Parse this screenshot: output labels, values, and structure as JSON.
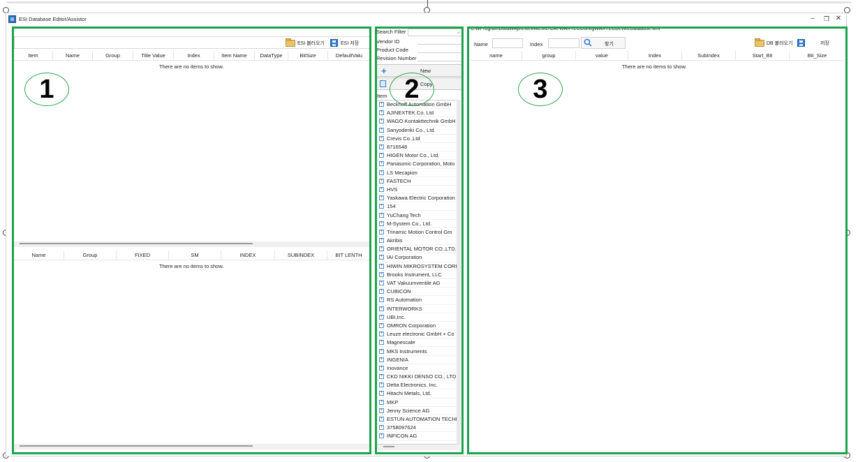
{
  "window": {
    "title": "ESI Database Editor/Assistor",
    "minimize_glyph": "–",
    "restore_glyph": "❐",
    "close_glyph": "✕"
  },
  "labels": {
    "region_1": "1",
    "region_2": "2",
    "region_3": "3"
  },
  "panel1": {
    "toolbar": {
      "load_label": "ESI 불러오기",
      "save_label": "ESI 저장"
    },
    "top_grid": {
      "columns": [
        "Item",
        "Name",
        "Group",
        "Title Value",
        "Index",
        "Item Name",
        "DataType",
        "BitSize",
        "DefaultValu"
      ],
      "empty_text": "There are no items to show."
    },
    "bottom_grid": {
      "columns": [
        "Name",
        "Group",
        "FIXED",
        "SM",
        "INDEX",
        "SUBINDEX",
        "BIT LENTH"
      ],
      "empty_text": "There are no items to show."
    }
  },
  "panel2": {
    "search_filter_label": "Search Filter",
    "search_filter_value": "",
    "vendor_id_label": "Vendor ID",
    "product_code_label": "Product Code",
    "revision_number_label": "Revision Number",
    "new_label": "New",
    "copy_label": "Copy",
    "list_header": "Item",
    "items": [
      "Beckhoff Automation GmbH",
      "AJINEXTEK Co. Ltd",
      "WAGO Kontakttechnik GmbH",
      "Sanyodenki Co., Ltd.",
      "Crevis Co.,Ltd",
      "8716548",
      "HIGEN Motor Co., Ltd.",
      "Panasonic Corporation, Moto",
      "LS Mecapion",
      "FASTECH",
      "HVS",
      "Yaskawa Electric Corporation",
      "154",
      "YuChang Tech",
      "M-System Co., Ltd.",
      "Trinamic Motion Control Gm",
      "Akribis",
      "ORIENTAL MOTOR CO.,LTD.",
      "IAI Corporation",
      "HIWIN MIKROSYSTEM CORP.",
      "Brooks Instrument, LLC",
      "VAT Vakuumventile AG",
      "CUBICON",
      "RS Automation",
      "INTERWORKS",
      "UBI,Inc.",
      "OMRON Corporation",
      "Leuze electronic GmbH + Co",
      "Magnescale",
      "MKS Instruments",
      "INGENIA",
      "Inovance",
      "CKD NIKKI DENSO CO., LTD.",
      "Delta Electronics, Inc.",
      "Hitachi Metals, Ltd.",
      "MKP",
      "Jenny Science AG",
      "ESTUN AUTOMATION TECHN",
      "3758097624",
      "INFICON AG"
    ]
  },
  "panel3": {
    "path": "C:₩ProgramData₩Ajinextek₩EtherCAT₩AXTECConfig₩AXTECDeviceDatabase.xml",
    "name_label": "Name",
    "name_value": "",
    "index_label": "Index",
    "index_value": "",
    "find_label": "찾기",
    "load_label": "DB 불러오기",
    "save_label": "저장",
    "grid": {
      "columns": [
        "name",
        "group",
        "value",
        "Index",
        "SubIndex",
        "Start_Bit",
        "Bit_Size"
      ],
      "empty_text": "There are no items to show."
    }
  },
  "colors": {
    "region_outline": "#1aa34a",
    "accent_blue": "#2e7bd2"
  }
}
